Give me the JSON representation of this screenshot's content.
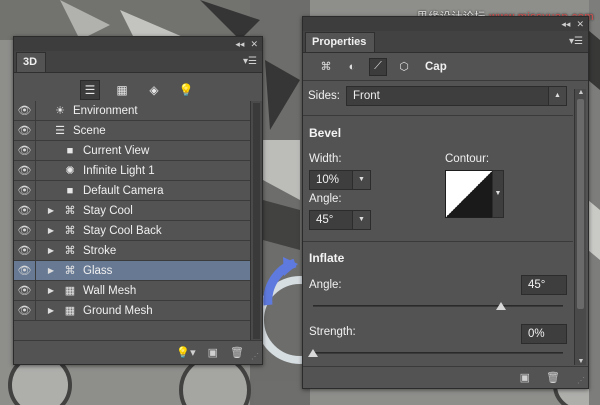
{
  "watermark": {
    "part1": "思缘设计论坛",
    "part2": " www.missyuan.com"
  },
  "panel3d": {
    "tab": "3D",
    "toolbar": [
      {
        "icon": "scene-filter-icon",
        "glyph": "☰",
        "active": true
      },
      {
        "icon": "mesh-filter-icon",
        "glyph": "▦",
        "active": false
      },
      {
        "icon": "material-filter-icon",
        "glyph": "◈",
        "active": false
      },
      {
        "icon": "light-filter-icon",
        "glyph": "💡",
        "active": false
      }
    ],
    "layers": [
      {
        "label": "Environment",
        "icon": "environment-icon",
        "glyph": "☀",
        "indent": 0,
        "arrow": false,
        "selected": false
      },
      {
        "label": "Scene",
        "icon": "scene-icon",
        "glyph": "☰",
        "indent": 0,
        "arrow": false,
        "selected": false
      },
      {
        "label": "Current View",
        "icon": "camera-icon",
        "glyph": "■",
        "indent": 1,
        "arrow": false,
        "selected": false
      },
      {
        "label": "Infinite Light 1",
        "icon": "light-icon",
        "glyph": "✺",
        "indent": 1,
        "arrow": false,
        "selected": false
      },
      {
        "label": "Default Camera",
        "icon": "camera-icon",
        "glyph": "■",
        "indent": 1,
        "arrow": false,
        "selected": false
      },
      {
        "label": "Stay  Cool",
        "icon": "mesh-icon",
        "glyph": "⌘",
        "indent": 1,
        "arrow": true,
        "selected": false
      },
      {
        "label": "Stay  Cool Back",
        "icon": "mesh-icon",
        "glyph": "⌘",
        "indent": 1,
        "arrow": true,
        "selected": false
      },
      {
        "label": "Stroke",
        "icon": "mesh-icon",
        "glyph": "⌘",
        "indent": 1,
        "arrow": true,
        "selected": false
      },
      {
        "label": "Glass",
        "icon": "mesh-icon",
        "glyph": "⌘",
        "indent": 1,
        "arrow": true,
        "selected": true
      },
      {
        "label": "Wall Mesh",
        "icon": "mesh-icon",
        "glyph": "▦",
        "indent": 1,
        "arrow": true,
        "selected": false
      },
      {
        "label": "Ground Mesh",
        "icon": "mesh-icon",
        "glyph": "▦",
        "indent": 1,
        "arrow": true,
        "selected": false
      }
    ]
  },
  "properties": {
    "tab": "Properties",
    "title": "Cap",
    "sides_label": "Sides:",
    "sides_value": "Front",
    "bevel": {
      "header": "Bevel",
      "width_label": "Width:",
      "width_value": "10%",
      "contour_label": "Contour:",
      "angle_label": "Angle:",
      "angle_value": "45°"
    },
    "inflate": {
      "header": "Inflate",
      "angle_label": "Angle:",
      "angle_value": "45°",
      "angle_fraction": 0.75,
      "strength_label": "Strength:",
      "strength_value": "0%",
      "strength_fraction": 0.0
    }
  }
}
